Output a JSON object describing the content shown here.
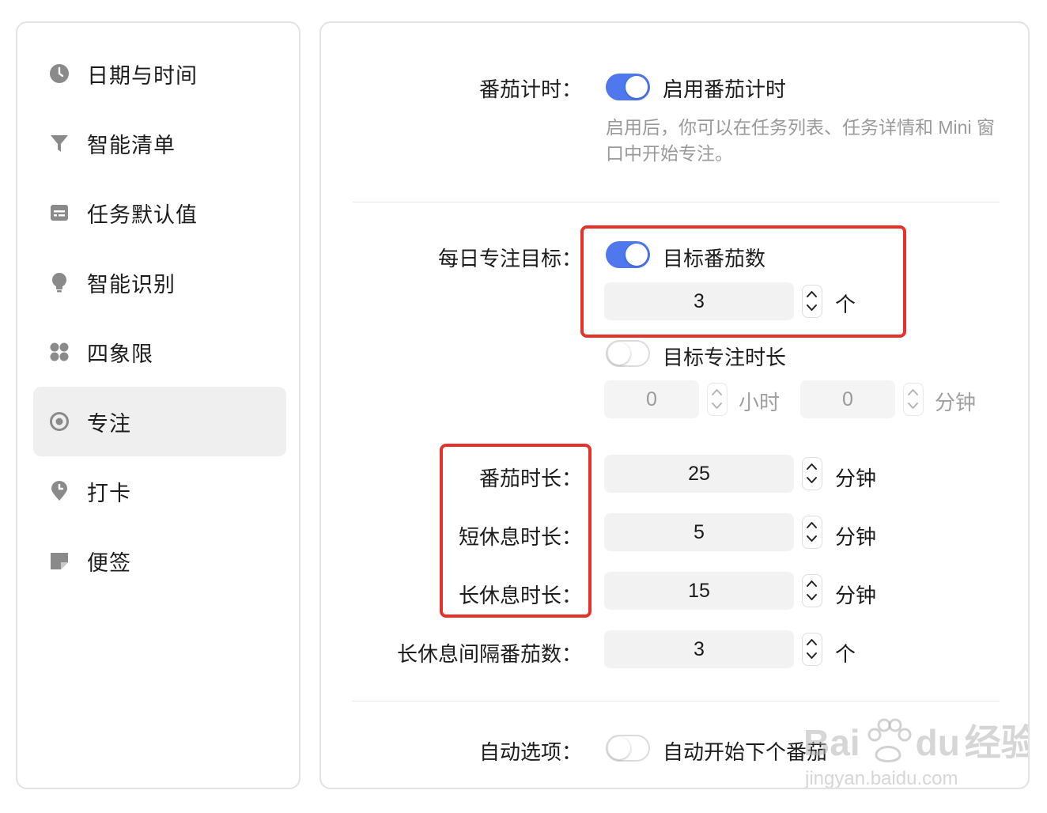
{
  "sidebar": {
    "items": [
      {
        "label": "日期与时间",
        "icon": "clock-icon"
      },
      {
        "label": "智能清单",
        "icon": "filter-icon"
      },
      {
        "label": "任务默认值",
        "icon": "task-card-icon"
      },
      {
        "label": "智能识别",
        "icon": "lightbulb-icon"
      },
      {
        "label": "四象限",
        "icon": "grid-quadrant-icon"
      },
      {
        "label": "专注",
        "icon": "target-icon",
        "active": true
      },
      {
        "label": "打卡",
        "icon": "pin-check-icon"
      },
      {
        "label": "便签",
        "icon": "sticky-note-icon"
      }
    ]
  },
  "pomodoro": {
    "label": "番茄计时：",
    "toggle_on": true,
    "toggle_label": "启用番茄计时",
    "description": "启用后，你可以在任务列表、任务详情和 Mini 窗口中开始专注。"
  },
  "daily_goal": {
    "label": "每日专注目标：",
    "pomo_goal": {
      "toggle_on": true,
      "toggle_label": "目标番茄数",
      "value": "3",
      "unit": "个"
    },
    "time_goal": {
      "toggle_on": false,
      "toggle_label": "目标专注时长",
      "hours": "0",
      "hours_unit": "小时",
      "minutes": "0",
      "minutes_unit": "分钟"
    }
  },
  "durations": {
    "pomo": {
      "label": "番茄时长：",
      "value": "25",
      "unit": "分钟"
    },
    "short_break": {
      "label": "短休息时长：",
      "value": "5",
      "unit": "分钟"
    },
    "long_break": {
      "label": "长休息时长：",
      "value": "15",
      "unit": "分钟"
    },
    "long_break_interval": {
      "label": "长休息间隔番茄数：",
      "value": "3",
      "unit": "个"
    }
  },
  "auto": {
    "label": "自动选项：",
    "toggle_on": false,
    "toggle_label": "自动开始下个番茄"
  },
  "watermark": {
    "brand": "Bai",
    "brand2": "du",
    "cn": "经验",
    "url": "jingyan.baidu.com"
  },
  "colors": {
    "accent": "#4f78ef",
    "highlight": "#e5322a",
    "active_bg": "#efefef"
  }
}
